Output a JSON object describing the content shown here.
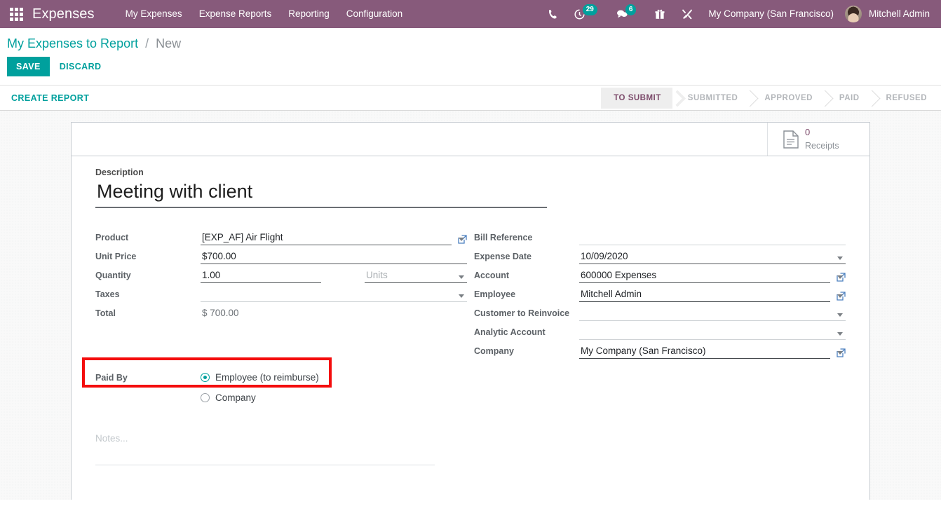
{
  "navbar": {
    "apps_icon": "apps-grid-icon",
    "brand": "Expenses",
    "menu": [
      {
        "label": "My Expenses"
      },
      {
        "label": "Expense Reports"
      },
      {
        "label": "Reporting"
      },
      {
        "label": "Configuration"
      }
    ],
    "sysicons": [
      {
        "name": "phone-icon",
        "badge": ""
      },
      {
        "name": "activity-clock-icon",
        "badge": "29"
      },
      {
        "name": "messages-icon",
        "badge": "6"
      },
      {
        "name": "gift-icon",
        "badge": ""
      },
      {
        "name": "tools-icon",
        "badge": ""
      }
    ],
    "company": "My Company (San Francisco)",
    "user": "Mitchell Admin",
    "colors": {
      "background": "#875A7B",
      "badge": "#00A09D"
    }
  },
  "control_panel": {
    "breadcrumb_root": "My Expenses to Report",
    "breadcrumb_separator": "/",
    "breadcrumb_current": "New",
    "save_label": "SAVE",
    "discard_label": "DISCARD",
    "accent": "#00A09D"
  },
  "statusbar": {
    "create_report_label": "CREATE REPORT",
    "stages": [
      {
        "label": "TO SUBMIT",
        "active": true
      },
      {
        "label": "SUBMITTED",
        "active": false
      },
      {
        "label": "APPROVED",
        "active": false
      },
      {
        "label": "PAID",
        "active": false
      },
      {
        "label": "REFUSED",
        "active": false
      }
    ]
  },
  "sheet": {
    "receipts": {
      "icon": "document-icon",
      "count": "0",
      "label": "Receipts"
    },
    "description": {
      "label": "Description",
      "value": "Meeting with client",
      "placeholder": ""
    },
    "left_fields": [
      {
        "label": "Product",
        "value": "[EXP_AF] Air Flight",
        "placeholder": "",
        "caret": true,
        "ext_link": true,
        "filled": true
      },
      {
        "label": "Unit Price",
        "value": "$700.00",
        "placeholder": "",
        "caret": false,
        "ext_link": false,
        "filled": true
      },
      {
        "label": "Quantity",
        "value": "1.00",
        "placeholder": "",
        "uom_value": "",
        "uom_placeholder": "Units",
        "caret": false,
        "ext_link": false,
        "filled": true
      },
      {
        "label": "Taxes",
        "value": "",
        "placeholder": "",
        "caret": true,
        "ext_link": false,
        "filled": false
      },
      {
        "label": "Total",
        "value": "$ 700.00",
        "readonly": true
      }
    ],
    "right_fields": [
      {
        "label": "Bill Reference",
        "value": "",
        "placeholder": "",
        "caret": false,
        "ext_link": false,
        "filled": false
      },
      {
        "label": "Expense Date",
        "value": "10/09/2020",
        "placeholder": "",
        "caret": true,
        "ext_link": false,
        "filled": true
      },
      {
        "label": "Account",
        "value": "600000 Expenses",
        "placeholder": "",
        "caret": true,
        "ext_link": true,
        "filled": true
      },
      {
        "label": "Employee",
        "value": "Mitchell Admin",
        "placeholder": "",
        "caret": true,
        "ext_link": true,
        "filled": true
      },
      {
        "label": "Customer to Reinvoice",
        "value": "",
        "placeholder": "",
        "caret": true,
        "ext_link": false,
        "filled": false
      },
      {
        "label": "Analytic Account",
        "value": "",
        "placeholder": "",
        "caret": true,
        "ext_link": false,
        "filled": false
      },
      {
        "label": "Company",
        "value": "My Company (San Francisco)",
        "placeholder": "",
        "caret": true,
        "ext_link": true,
        "filled": true
      }
    ],
    "paid_by": {
      "label": "Paid By",
      "options": [
        {
          "label": "Employee (to reimburse)",
          "selected": true
        },
        {
          "label": "Company",
          "selected": false
        }
      ],
      "highlight_color": "#f40d0d"
    },
    "notes": {
      "placeholder": "Notes...",
      "value": ""
    }
  }
}
